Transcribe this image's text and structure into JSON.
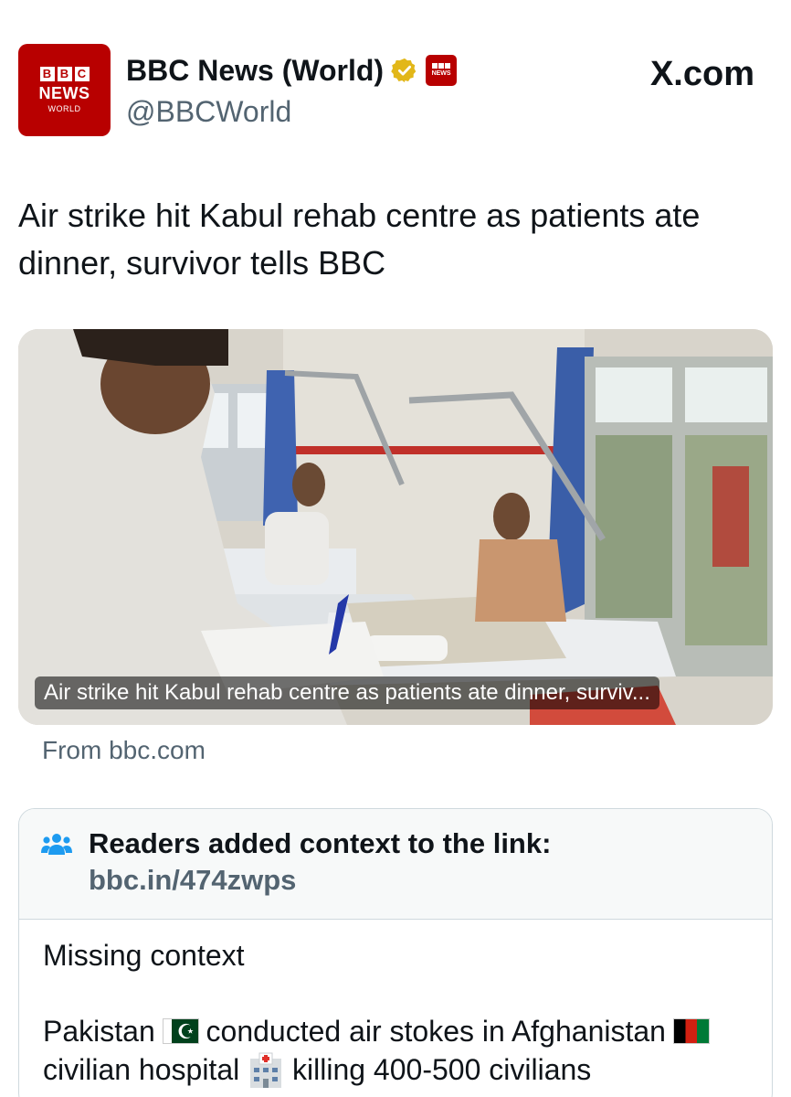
{
  "account": {
    "avatar": {
      "blocks": [
        "B",
        "B",
        "C"
      ],
      "news": "NEWS",
      "world": "WORLD"
    },
    "display_name": "BBC News (World)",
    "handle": "@BBCWorld",
    "mini_badge": "NEWS",
    "verified_icon": "verified-badge-icon"
  },
  "site_watermark": "X.com",
  "tweet": {
    "text": "Air strike hit Kabul rehab centre as patients ate dinner, survivor tells BBC"
  },
  "link_card": {
    "caption": "Air strike hit Kabul rehab centre as patients ate dinner, surviv...",
    "from": "From bbc.com",
    "image_icon": "hospital-ward-photo"
  },
  "community_note": {
    "header_prefix": "Readers added context to the link: ",
    "header_link": "bbc.in/474zwps",
    "category": "Missing context",
    "body_parts": [
      "Pakistan ",
      " conducted air stokes in Afghanistan ",
      " civilian hospital ",
      " killing 400-500 civilians"
    ],
    "icons": [
      "pakistan-flag-icon",
      "afghanistan-flag-icon",
      "hospital-icon"
    ]
  },
  "colors": {
    "bbc_red": "#b80000",
    "text_primary": "#0f1419",
    "text_secondary": "#536471",
    "note_header_bg": "#f7f9f9",
    "border": "#cfd9de",
    "verified_gold": "#e2b719"
  }
}
